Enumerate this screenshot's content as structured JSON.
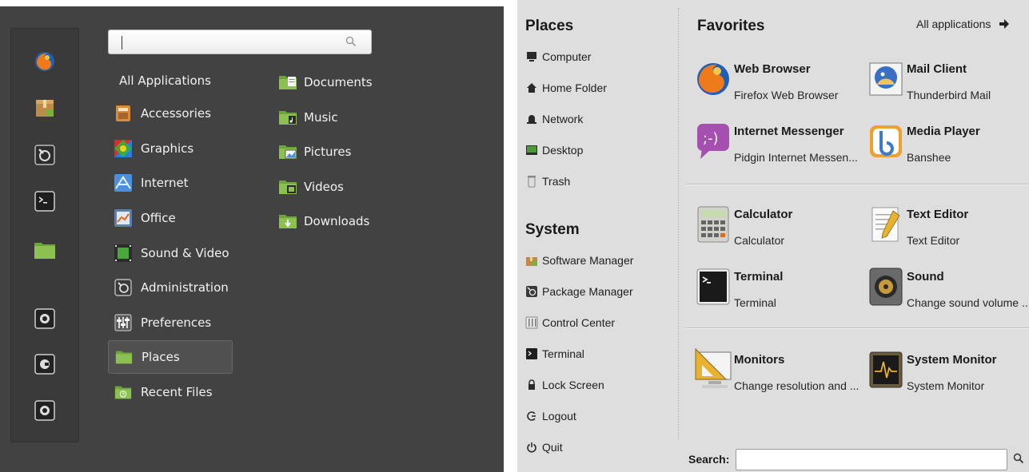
{
  "cinnamon": {
    "search": {
      "value": ""
    },
    "favorites": [
      "firefox-icon",
      "package-icon",
      "settings-icon",
      "terminal-icon",
      "folder-icon"
    ],
    "session_buttons": [
      "lock-icon",
      "logout-icon",
      "power-icon"
    ],
    "categories": [
      {
        "label": "All Applications",
        "icon": ""
      },
      {
        "label": "Accessories",
        "icon": "calculator-icon"
      },
      {
        "label": "Graphics",
        "icon": "palette-icon"
      },
      {
        "label": "Internet",
        "icon": "globe-icon"
      },
      {
        "label": "Office",
        "icon": "chart-icon"
      },
      {
        "label": "Sound & Video",
        "icon": "film-icon"
      },
      {
        "label": "Administration",
        "icon": "tools-icon"
      },
      {
        "label": "Preferences",
        "icon": "sliders-icon"
      },
      {
        "label": "Places",
        "icon": "folder-icon"
      },
      {
        "label": "Recent Files",
        "icon": "recent-folder-icon"
      }
    ],
    "selected_category": "Places",
    "places": [
      {
        "label": "Documents",
        "icon": "documents-folder-icon"
      },
      {
        "label": "Music",
        "icon": "music-folder-icon"
      },
      {
        "label": "Pictures",
        "icon": "pictures-folder-icon"
      },
      {
        "label": "Videos",
        "icon": "videos-folder-icon"
      },
      {
        "label": "Downloads",
        "icon": "downloads-folder-icon"
      }
    ],
    "colors": {
      "panel_bg": "#424242",
      "text": "#f2f2f2",
      "folder_green": "#7fb346"
    }
  },
  "mint": {
    "places_title": "Places",
    "places": [
      {
        "label": "Computer",
        "icon": "computer-icon"
      },
      {
        "label": "Home Folder",
        "icon": "home-icon"
      },
      {
        "label": "Network",
        "icon": "network-icon"
      },
      {
        "label": "Desktop",
        "icon": "desktop-icon"
      },
      {
        "label": "Trash",
        "icon": "trash-icon"
      }
    ],
    "system_title": "System",
    "system": [
      {
        "label": "Software Manager",
        "icon": "software-manager-icon"
      },
      {
        "label": "Package Manager",
        "icon": "package-manager-icon"
      },
      {
        "label": "Control Center",
        "icon": "control-center-icon"
      },
      {
        "label": "Terminal",
        "icon": "terminal-icon"
      },
      {
        "label": "Lock Screen",
        "icon": "lock-icon"
      },
      {
        "label": "Logout",
        "icon": "logout-icon"
      },
      {
        "label": "Quit",
        "icon": "power-icon"
      }
    ],
    "favorites_title": "Favorites",
    "all_applications": "All applications",
    "apps": [
      {
        "name": "Web Browser",
        "desc": "Firefox Web Browser",
        "icon": "firefox-icon"
      },
      {
        "name": "Mail Client",
        "desc": "Thunderbird Mail",
        "icon": "thunderbird-icon"
      },
      {
        "name": "Internet Messenger",
        "desc": "Pidgin Internet Messen...",
        "icon": "pidgin-icon"
      },
      {
        "name": "Media Player",
        "desc": "Banshee",
        "icon": "banshee-icon"
      },
      {
        "name": "Calculator",
        "desc": "Calculator",
        "icon": "calculator-icon"
      },
      {
        "name": "Text Editor",
        "desc": "Text Editor",
        "icon": "text-editor-icon"
      },
      {
        "name": "Terminal",
        "desc": "Terminal",
        "icon": "terminal-icon"
      },
      {
        "name": "Sound",
        "desc": "Change sound volume ...",
        "icon": "speaker-icon"
      },
      {
        "name": "Monitors",
        "desc": "Change resolution and ...",
        "icon": "monitor-icon"
      },
      {
        "name": "System Monitor",
        "desc": "System Monitor",
        "icon": "system-monitor-icon"
      }
    ],
    "search_label": "Search:",
    "search_value": "",
    "colors": {
      "panel_bg": "#dedede",
      "text": "#1a1a1a"
    }
  }
}
